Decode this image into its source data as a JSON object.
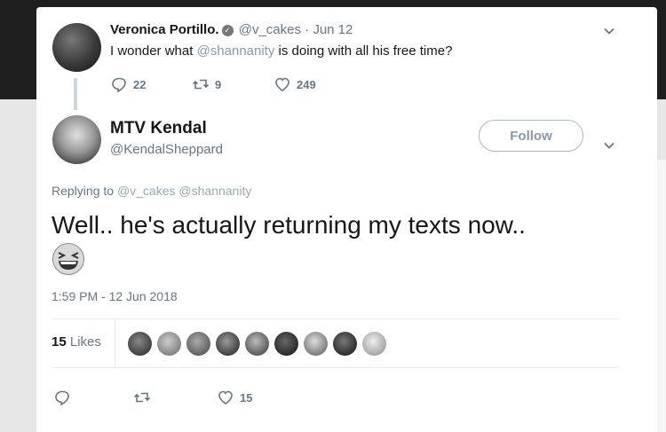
{
  "parent_tweet": {
    "name": "Veronica Portillo.",
    "handle": "@v_cakes",
    "separator": "·",
    "date": "Jun 12",
    "text_before": "I wonder what ",
    "mention": "@shannanity",
    "text_after": " is doing with all his free time?",
    "replies": "22",
    "retweets": "9",
    "likes": "249"
  },
  "main_tweet": {
    "name": "MTV Kendal",
    "handle": "@KendalSheppard",
    "follow_label": "Follow",
    "replying_label": "Replying to",
    "replying_to": [
      "@v_cakes",
      "@shannanity"
    ],
    "text": "Well.. he's actually returning my texts now..",
    "timestamp": "1:59 PM - 12 Jun 2018",
    "likes_count": "15",
    "likes_label": "Likes",
    "like_action_count": "15"
  },
  "likers": [
    "liker-1",
    "liker-2",
    "liker-3",
    "liker-4",
    "liker-5",
    "liker-6",
    "liker-7",
    "liker-8",
    "liker-9"
  ],
  "icons": [
    "verified-icon",
    "reply-icon",
    "retweet-icon",
    "heart-icon",
    "chevron-down-icon",
    "laughing-emoji-icon"
  ],
  "colors": {
    "muted": "#657786",
    "border": "#e6ecf0",
    "follow_border": "#aab8c2"
  }
}
